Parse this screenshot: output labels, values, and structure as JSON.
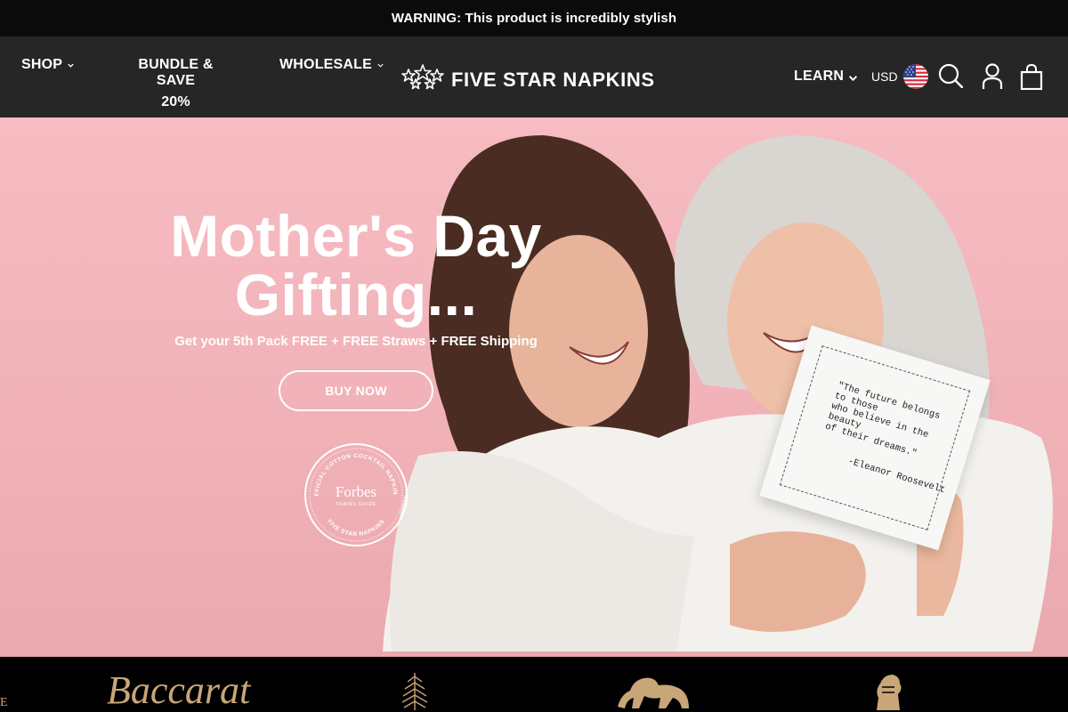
{
  "announcement": {
    "text": "WARNING: This product is incredibly stylish"
  },
  "nav": {
    "shop": "SHOP",
    "bundle_line1": "BUNDLE & SAVE",
    "bundle_line2": "20%",
    "wholesale": "WHOLESALE",
    "learn": "LEARN"
  },
  "logo": {
    "text": "FIVE STAR NAPKINS"
  },
  "currency": {
    "code": "USD",
    "flag_icon": "us-flag-icon"
  },
  "header_icons": [
    "search-icon",
    "account-icon",
    "cart-icon"
  ],
  "hero": {
    "title_line1": "Mother's Day",
    "title_line2": "Gifting...",
    "subtitle": "Get your 5th Pack FREE + FREE Straws + FREE Shipping",
    "button": "BUY NOW",
    "badge": {
      "brand": "Forbes",
      "sub": "TRAVEL GUIDE",
      "ring_top": "THE OFFICIAL COTTON COCKTAIL NAPKINS 2024",
      "ring_bottom": "FIVE STAR NAPKINS"
    },
    "quote": {
      "line1": "\"The future belongs to those",
      "line2": "who believe in the beauty",
      "line3": "of their dreams.\"",
      "author": "-Eleanor Roosevelt"
    }
  },
  "brands": {
    "baccarat": "Baccarat",
    "edge_letter": "E"
  },
  "colors": {
    "announcement_bg": "#0b0b0b",
    "header_bg": "#262626",
    "hero_bg": "#f4b7bd",
    "brand_gold": "#c9a678"
  }
}
